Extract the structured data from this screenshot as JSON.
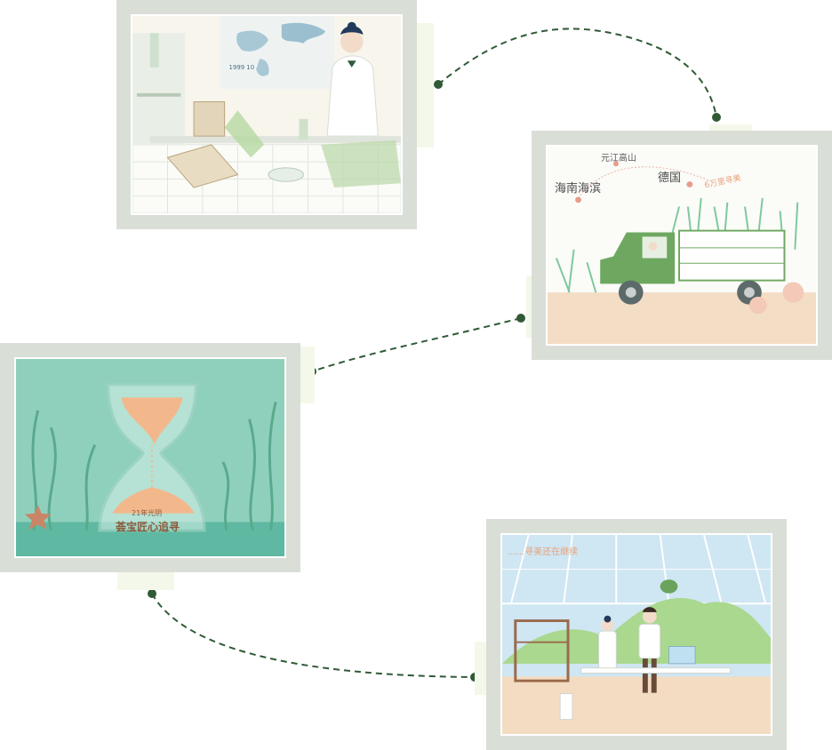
{
  "illustrations": [
    {
      "id": "lab-scientist",
      "map_note": "1999 10"
    },
    {
      "id": "truck-journey",
      "places": [
        "元江高山",
        "海南海滨",
        "德国"
      ],
      "distance_note": "6万里寻美"
    },
    {
      "id": "hourglass",
      "caption_small": "21年光阴",
      "caption_large": "荟宝匠心追寻"
    },
    {
      "id": "greenhouse",
      "caption": "......寻美还在继续"
    }
  ],
  "colors": {
    "frame": "#d9dfd6",
    "path": "#2f5a35",
    "accent_orange": "#e8a27a",
    "sea": "#8fd0bd"
  }
}
